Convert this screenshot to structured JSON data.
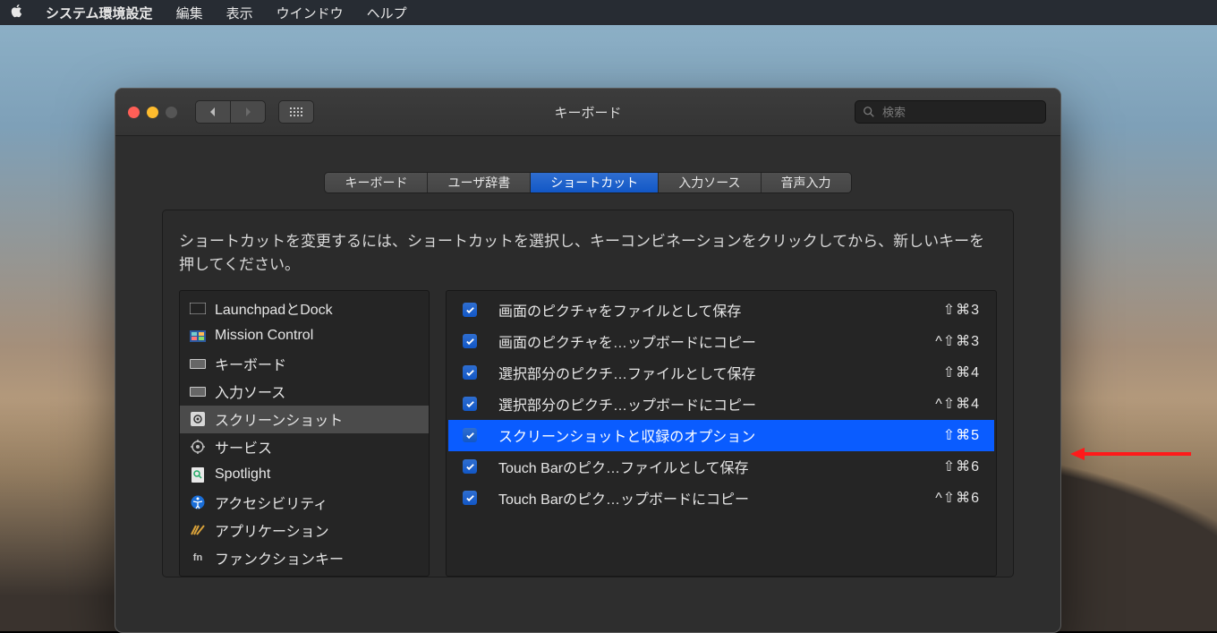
{
  "menubar": {
    "app": "システム環境設定",
    "items": [
      "編集",
      "表示",
      "ウインドウ",
      "ヘルプ"
    ]
  },
  "window": {
    "title": "キーボード",
    "search_placeholder": "検索"
  },
  "tabs": [
    {
      "label": "キーボード",
      "active": false
    },
    {
      "label": "ユーザ辞書",
      "active": false
    },
    {
      "label": "ショートカット",
      "active": true
    },
    {
      "label": "入力ソース",
      "active": false
    },
    {
      "label": "音声入力",
      "active": false
    }
  ],
  "instruction": "ショートカットを変更するには、ショートカットを選択し、キーコンビネーションをクリックしてから、新しいキーを押してください。",
  "sidebar": [
    {
      "icon": "launchpad",
      "label": "LaunchpadとDock",
      "selected": false
    },
    {
      "icon": "mission",
      "label": "Mission Control",
      "selected": false
    },
    {
      "icon": "keyboard",
      "label": "キーボード",
      "selected": false
    },
    {
      "icon": "input",
      "label": "入力ソース",
      "selected": false
    },
    {
      "icon": "screenshot",
      "label": "スクリーンショット",
      "selected": true
    },
    {
      "icon": "services",
      "label": "サービス",
      "selected": false
    },
    {
      "icon": "spotlight",
      "label": "Spotlight",
      "selected": false
    },
    {
      "icon": "accessibility",
      "label": "アクセシビリティ",
      "selected": false
    },
    {
      "icon": "app",
      "label": "アプリケーション",
      "selected": false
    },
    {
      "icon": "fn",
      "label": "ファンクションキー",
      "selected": false
    }
  ],
  "shortcuts": [
    {
      "checked": true,
      "label": "画面のピクチャをファイルとして保存",
      "key": "⇧⌘3",
      "selected": false
    },
    {
      "checked": true,
      "label": "画面のピクチャを…ップボードにコピー",
      "key": "^⇧⌘3",
      "selected": false
    },
    {
      "checked": true,
      "label": "選択部分のピクチ…ファイルとして保存",
      "key": "⇧⌘4",
      "selected": false
    },
    {
      "checked": true,
      "label": "選択部分のピクチ…ップボードにコピー",
      "key": "^⇧⌘4",
      "selected": false
    },
    {
      "checked": true,
      "label": "スクリーンショットと収録のオプション",
      "key": "⇧⌘5",
      "selected": true
    },
    {
      "checked": true,
      "label": "Touch Barのピク…ファイルとして保存",
      "key": "⇧⌘6",
      "selected": false
    },
    {
      "checked": true,
      "label": "Touch Barのピク…ップボードにコピー",
      "key": "^⇧⌘6",
      "selected": false
    }
  ]
}
